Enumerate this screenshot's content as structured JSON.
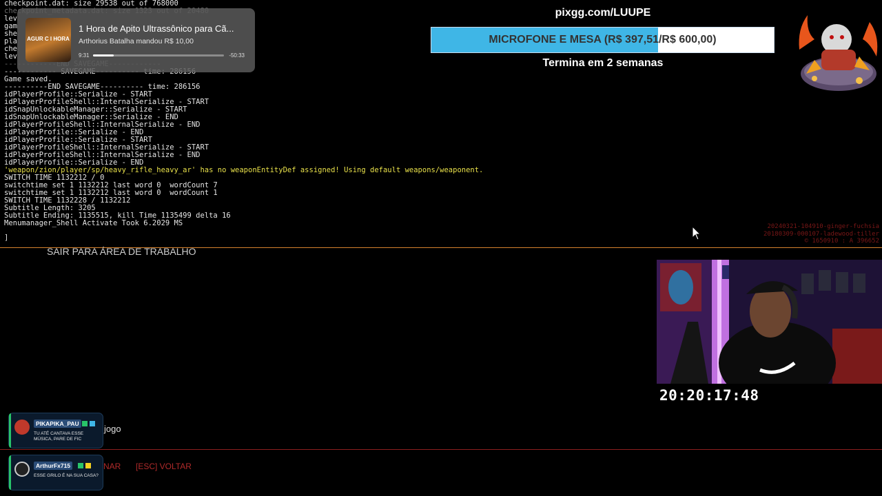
{
  "console": {
    "lines": [
      {
        "text": "checkpoint.dat: size 29538 out of 768000",
        "style": "normal"
      },
      {
        "text": "checkpoint_metadata.dat: size 1323 out of 20480",
        "style": "faded"
      },
      {
        "text": "lev",
        "style": "normal"
      },
      {
        "text": "gam",
        "style": "normal"
      },
      {
        "text": "she",
        "style": "normal"
      },
      {
        "text": "pla",
        "style": "normal"
      },
      {
        "text": "che",
        "style": "normal"
      },
      {
        "text": "lev",
        "style": "normal"
      },
      {
        "text": "------------END SAVEGAME------------",
        "style": "faded"
      },
      {
        "text": "------------ SAVEGAME---------- time: 286156",
        "style": "normal"
      },
      {
        "text": "Game saved.",
        "style": "normal"
      },
      {
        "text": "----------END SAVEGAME---------- time: 286156",
        "style": "normal"
      },
      {
        "text": "idPlayerProfile::Serialize - START",
        "style": "normal"
      },
      {
        "text": "idPlayerProfileShell::InternalSerialize - START",
        "style": "normal"
      },
      {
        "text": "idSnapUnlockableManager::Serialize - START",
        "style": "normal"
      },
      {
        "text": "idSnapUnlockableManager::Serialize - END",
        "style": "normal"
      },
      {
        "text": "idPlayerProfileShell::InternalSerialize - END",
        "style": "normal"
      },
      {
        "text": "idPlayerProfile::Serialize - END",
        "style": "normal"
      },
      {
        "text": "idPlayerProfile::Serialize - START",
        "style": "normal"
      },
      {
        "text": "idPlayerProfileShell::InternalSerialize - START",
        "style": "normal"
      },
      {
        "text": "idPlayerProfileShell::InternalSerialize - END",
        "style": "normal"
      },
      {
        "text": "idPlayerProfile::Serialize - END",
        "style": "normal"
      },
      {
        "text": "'weapon/zion/player/sp/heavy_rifle_heavy_ar' has no weaponEntityDef assigned! Using default weapons/weaponent.",
        "style": "warn"
      },
      {
        "text": "SWITCH TIME 1132212 / 0",
        "style": "normal"
      },
      {
        "text": "switchtime set 1 1132212 last word 0  wordCount 7",
        "style": "normal"
      },
      {
        "text": "switchtime set 1 1132212 last word 0  wordCount 1",
        "style": "normal"
      },
      {
        "text": "SWITCH TIME 1132228 / 1132212",
        "style": "normal"
      },
      {
        "text": "Subtitle Length: 3205",
        "style": "normal"
      },
      {
        "text": "Subtitle Ending: 1135515, kill Time 1135499 delta 16",
        "style": "normal"
      },
      {
        "text": "Menumanager_Shell Activate Took 6.2029 MS",
        "style": "normal"
      }
    ],
    "prompt": "]"
  },
  "music": {
    "thumb_text": "AGUR C I HORA",
    "title": "1 Hora de Apito Ultrassônico para Cã...",
    "subtitle": "Arthorius Batalha mandou R$ 10,00",
    "time_current": "9:31",
    "time_remaining": "-50:33",
    "progress": 0.16
  },
  "goal": {
    "url": "pixgg.com/LUUPE",
    "label": "MICROFONE E MESA (R$ 397,51/R$ 600,00)",
    "progress": 0.6625,
    "ends": "Termina em 2 semanas",
    "fill_color": "#3fb6e6"
  },
  "menu": {
    "exit_label": "SAIR PARA ÁREA DE TRABALHO",
    "nav_partial": "NAR",
    "nav_back": "[ESC] VOLTAR"
  },
  "watermark": {
    "lines": [
      "20240321-104910-ginger-fuchsia",
      "20180309-000107-ladewood-tiller",
      "© 1650910 : A 396652"
    ]
  },
  "clock": "20:20:17:48",
  "game_text": "jogo",
  "chat": [
    {
      "user": "PIKAPIKA_PAU",
      "message": "TU ATÉ CANTAVA ESSE MÚSICA, PARE DE FIC",
      "avatar_color": "#c0392b"
    },
    {
      "user": "ArthurFx715",
      "message": "ESSE GRILO É NA SUA CASA?",
      "avatar_color": "#222222"
    }
  ],
  "icons": {
    "cursor": "mouse-pointer-icon",
    "logo": "kratos-mascot-logo",
    "webcam": "streamer-webcam-feed"
  }
}
